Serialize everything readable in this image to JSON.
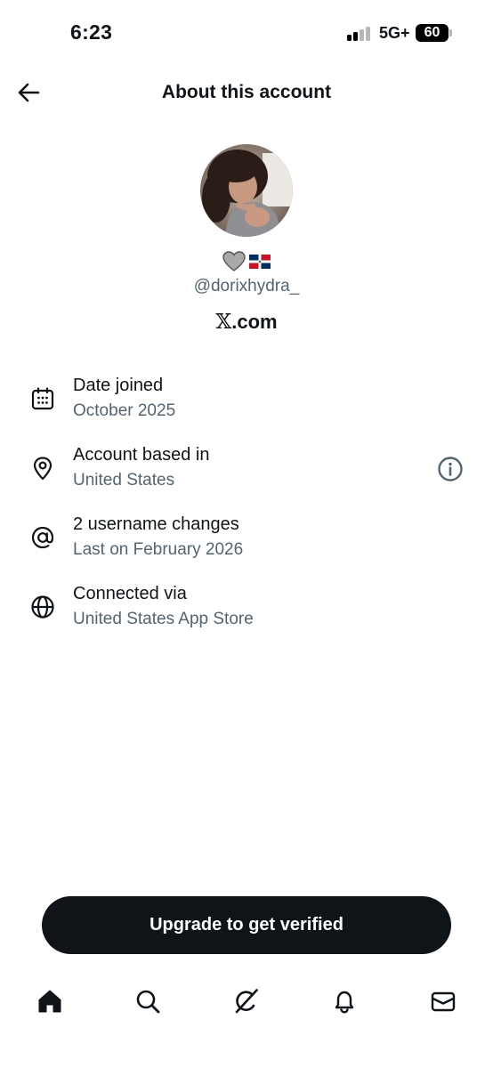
{
  "status_bar": {
    "time": "6:23",
    "network": "5G+",
    "battery": "60"
  },
  "header": {
    "title": "About this account"
  },
  "profile": {
    "display_name_emoji": [
      "gray-heart-icon",
      "dominican-republic-flag-icon"
    ],
    "handle": "@dorixhydra_",
    "site_mark": "𝕏",
    "site_text": ".com"
  },
  "info_rows": [
    {
      "icon": "calendar-icon",
      "title": "Date joined",
      "subtitle": "October 2025"
    },
    {
      "icon": "location-pin-icon",
      "title": "Account based in",
      "subtitle": "United States",
      "action_icon": "info-icon"
    },
    {
      "icon": "at-sign-icon",
      "title": "2 username changes",
      "subtitle": "Last on February 2026"
    },
    {
      "icon": "globe-icon",
      "title": "Connected via",
      "subtitle": "United States App Store"
    }
  ],
  "cta": {
    "label": "Upgrade to get verified"
  },
  "bottom_nav": {
    "items": [
      "home-icon",
      "search-icon",
      "grok-icon",
      "notifications-bell-icon",
      "messages-envelope-icon"
    ],
    "active": "home-icon"
  },
  "colors": {
    "text_primary": "#0f1419",
    "text_secondary": "#536471",
    "button_bg": "#0f1419",
    "background": "#ffffff"
  }
}
